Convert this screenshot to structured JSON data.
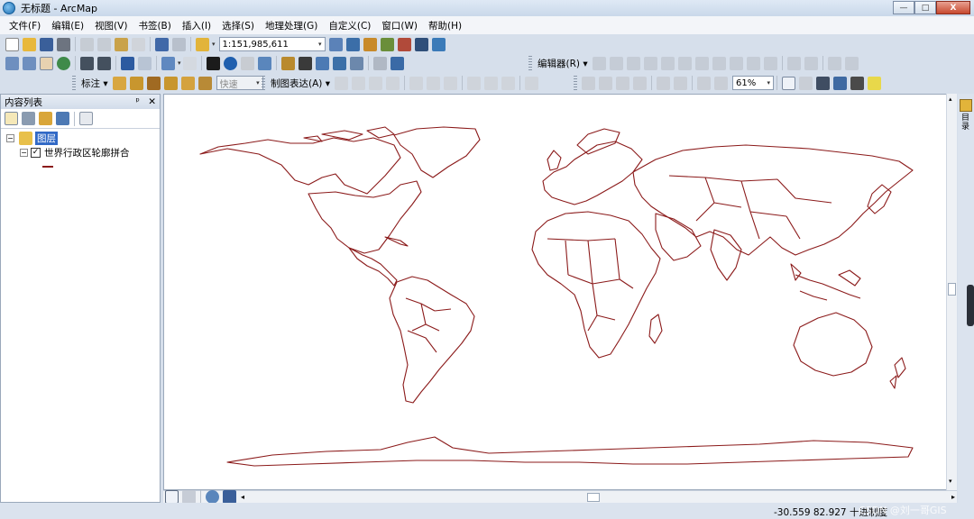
{
  "window": {
    "title": "无标题 - ArcMap",
    "minimize": "—",
    "maximize": "□",
    "close": "X"
  },
  "menu": [
    "文件(F)",
    "编辑(E)",
    "视图(V)",
    "书签(B)",
    "插入(I)",
    "选择(S)",
    "地理处理(G)",
    "自定义(C)",
    "窗口(W)",
    "帮助(H)"
  ],
  "toolbar": {
    "scale_value": "1:151,985,611",
    "editor_label": "编辑器(R) ▾",
    "label_label": "标注 ▾",
    "label_mode": "快速",
    "cartographic_label": "制图表达(A) ▾",
    "zoom_percent": "61%"
  },
  "toc": {
    "title": "内容列表",
    "pin": "ᵖ",
    "close": "✕",
    "group_name": "图层",
    "layer_name": "世界行政区轮廓拼合",
    "expander_collapse": "−",
    "checkbox_mark": "✓"
  },
  "right_pane": {
    "label": "目录"
  },
  "status": {
    "coordinates": "-30.559  82.927 十进制度",
    "watermark": "CSDN @刘一哥GIS"
  },
  "colors": {
    "map_outline": "#8b1a1a",
    "accent": "#1c6bb0"
  }
}
